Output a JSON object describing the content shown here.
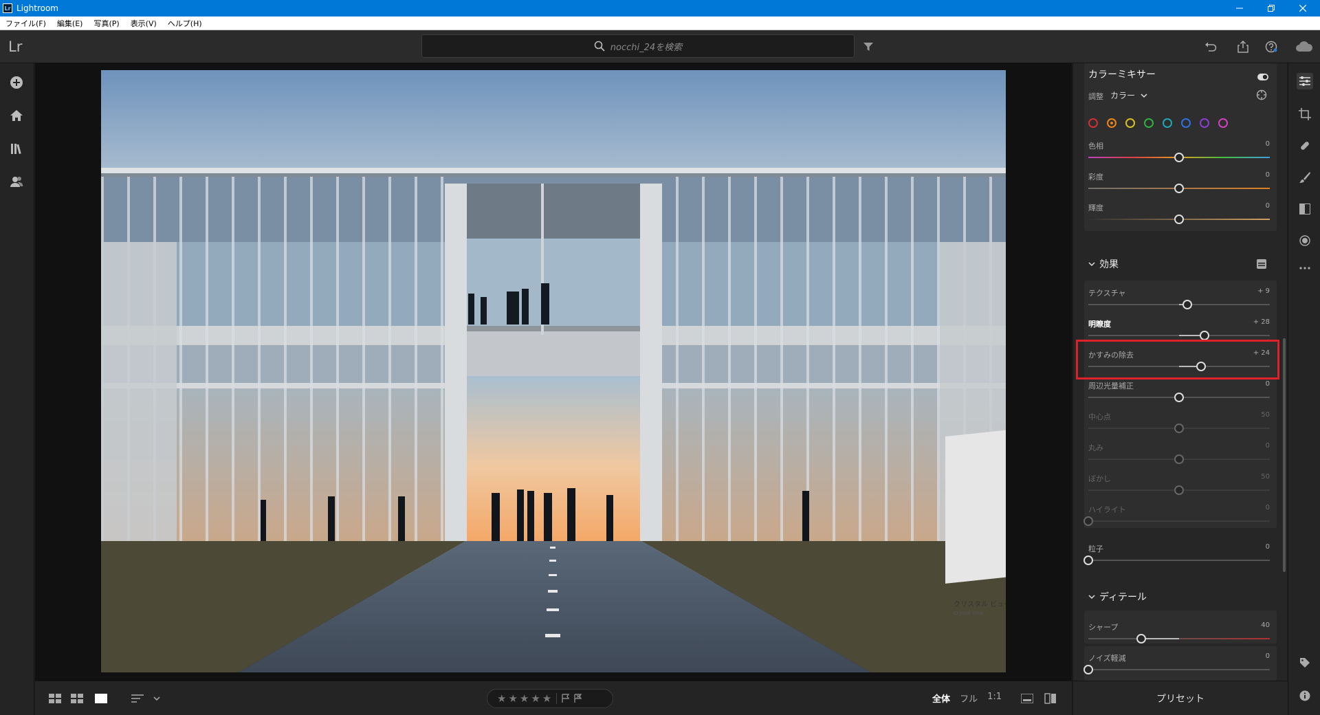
{
  "window": {
    "title": "Lightroom",
    "logo_text": "Lr"
  },
  "menu": {
    "items": [
      "ファイル(F)",
      "編集(E)",
      "写真(P)",
      "表示(V)",
      "ヘルプ(H)"
    ]
  },
  "topbar": {
    "logo": "Lr",
    "search_placeholder": "nocchi_24を検索"
  },
  "panel": {
    "color_mixer": {
      "title": "カラーミキサー",
      "adjust_label": "調整",
      "adjust_value": "カラー",
      "colors": [
        "#d23030",
        "#e8831a",
        "#d8c020",
        "#30b040",
        "#20a8b8",
        "#3070e0",
        "#8840d0",
        "#d040c0"
      ],
      "selected_color_index": 1,
      "sliders": [
        {
          "label": "色相",
          "value": "0",
          "position": 0.5
        },
        {
          "label": "彩度",
          "value": "0",
          "position": 0.5
        },
        {
          "label": "輝度",
          "value": "0",
          "position": 0.5
        }
      ]
    },
    "effects": {
      "title": "効果",
      "sliders": [
        {
          "label": "テクスチャ",
          "value": "+ 9",
          "position": 0.545,
          "state": "normal"
        },
        {
          "label": "明瞭度",
          "value": "+ 28",
          "position": 0.64,
          "state": "bright"
        },
        {
          "label": "かすみの除去",
          "value": "+ 24",
          "position": 0.62,
          "state": "normal"
        },
        {
          "label": "周辺光量補正",
          "value": "0",
          "position": 0.5,
          "state": "normal"
        },
        {
          "label": "中心点",
          "value": "50",
          "position": 0.5,
          "state": "dim"
        },
        {
          "label": "丸み",
          "value": "0",
          "position": 0.5,
          "state": "dim"
        },
        {
          "label": "ぼかし",
          "value": "50",
          "position": 0.5,
          "state": "dim"
        },
        {
          "label": "ハイライト",
          "value": "0",
          "position": 0.0,
          "state": "dim"
        }
      ],
      "grain": {
        "label": "粒子",
        "value": "0",
        "position": 0.0
      }
    },
    "detail": {
      "title": "ディテール",
      "sliders": [
        {
          "label": "シャープ",
          "value": "40",
          "position": 0.29
        },
        {
          "label": "ノイズ軽減",
          "value": "0",
          "position": 0.0
        }
      ]
    },
    "presets_label": "プリセット"
  },
  "bottombar": {
    "stars": "★★★★★",
    "zoom": {
      "fit": "全体",
      "fill": "フル",
      "one_to_one": "1:1"
    }
  },
  "photo": {
    "sign_title": "クリスタル ビュー",
    "sign_subtitle": "Crystal View"
  }
}
